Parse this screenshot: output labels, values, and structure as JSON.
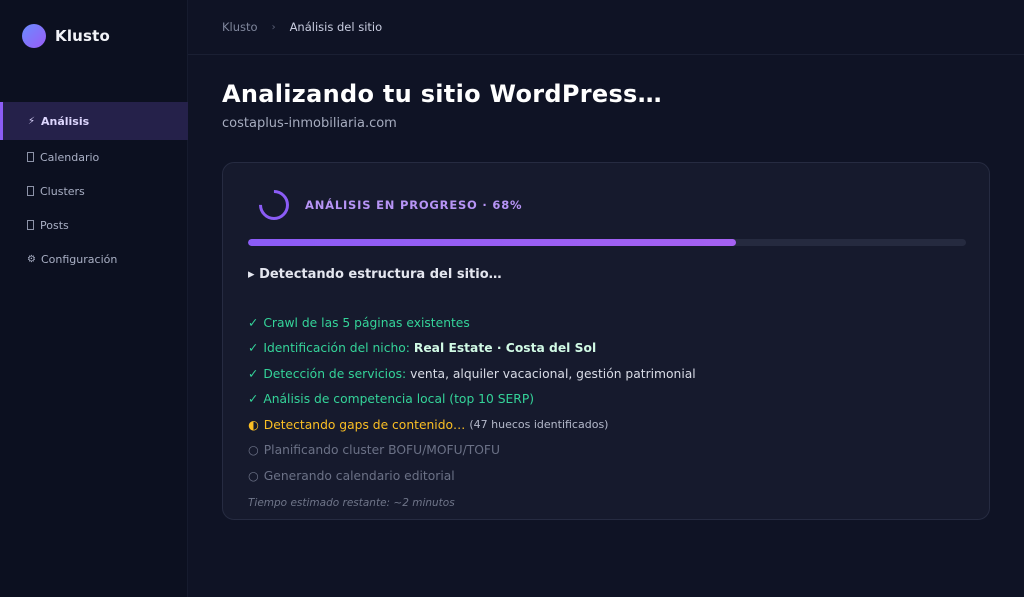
{
  "brand": {
    "name": "Klusto"
  },
  "colors": {
    "accent": "#8b5cf6",
    "success": "#34d399",
    "warning": "#fbbf24",
    "pending": "#6b7186"
  },
  "sidebar": {
    "items": [
      {
        "icon": "⚡",
        "icon_name": "lightning-icon",
        "label": "Análisis",
        "active": true
      },
      {
        "icon": "",
        "icon_name": "calendar-icon",
        "label": "Calendario"
      },
      {
        "icon": "",
        "icon_name": "clusters-icon",
        "label": "Clusters"
      },
      {
        "icon": "",
        "icon_name": "posts-icon",
        "label": "Posts"
      },
      {
        "icon": "⚙",
        "icon_name": "gear-icon",
        "label": "Configuración"
      }
    ]
  },
  "breadcrumb": {
    "root": "Klusto",
    "separator": "›",
    "current": "Análisis del sitio"
  },
  "page": {
    "title": "Analizando tu sitio WordPress…",
    "site": "costaplus-inmobiliaria.com"
  },
  "progress": {
    "label": "ANÁLISIS EN PROGRESO · 68%",
    "percent": 68,
    "stage_arrow": "▸",
    "stage": "Detectando estructura del sitio…"
  },
  "steps": [
    {
      "status": "done",
      "mark": "✓",
      "text": "Crawl de las 5 páginas existentes"
    },
    {
      "status": "done",
      "mark": "✓",
      "text": "Identificación del nicho:",
      "strong": "Real Estate · Costa del Sol"
    },
    {
      "status": "done",
      "mark": "✓",
      "text": "Detección de servicios:",
      "plain": "venta, alquiler vacacional, gestión patrimonial"
    },
    {
      "status": "done",
      "mark": "✓",
      "text": "Análisis de competencia local (top 10 SERP)"
    },
    {
      "status": "active",
      "mark": "◐",
      "text": "Detectando gaps de contenido…",
      "note": "(47 huecos identificados)"
    },
    {
      "status": "pending",
      "mark": "○",
      "text": "Planificando cluster BOFU/MOFU/TOFU"
    },
    {
      "status": "pending",
      "mark": "○",
      "text": "Generando calendario editorial"
    }
  ],
  "eta": "Tiempo estimado restante: ~2 minutos"
}
